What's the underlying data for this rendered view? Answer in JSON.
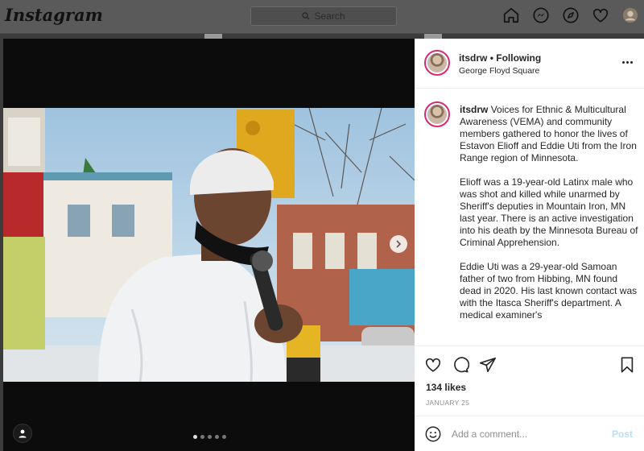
{
  "nav": {
    "logo": "Instagram",
    "search_placeholder": "Search",
    "icons": [
      "home-icon",
      "messenger-icon",
      "explore-icon",
      "heart-icon",
      "profile-avatar"
    ]
  },
  "post": {
    "username": "itsdrw",
    "separator": "•",
    "follow_status": "Following",
    "location": "George Floyd Square",
    "caption_paragraphs": [
      "Voices for Ethnic & Multicultural Awareness (VEMA) and community members gathered to honor the lives of Estavon Elioff and Eddie Uti from the Iron Range region of Minnesota.",
      "Elioff was a 19-year-old Latinx male who was shot and killed while unarmed by Sheriff's deputies in Mountain Iron, MN last year. There is an active investigation into his death by the Minnesota Bureau of Criminal Apprehension.",
      "Eddie Uti was a 29-year-old Samoan father of two from Hibbing, MN found dead in 2020. His last known contact was with the Itasca Sheriff's department. A medical examiner's"
    ],
    "likes": "134 likes",
    "date": "JANUARY 25",
    "carousel": {
      "total": 5,
      "active_index": 0
    }
  },
  "comment": {
    "placeholder": "Add a comment...",
    "post_label": "Post"
  },
  "colors": {
    "accent": "#0095f6",
    "post_disabled": "#b2dffc",
    "story_ring": "#d62976",
    "text": "#262626",
    "muted": "#8e8e8e"
  }
}
